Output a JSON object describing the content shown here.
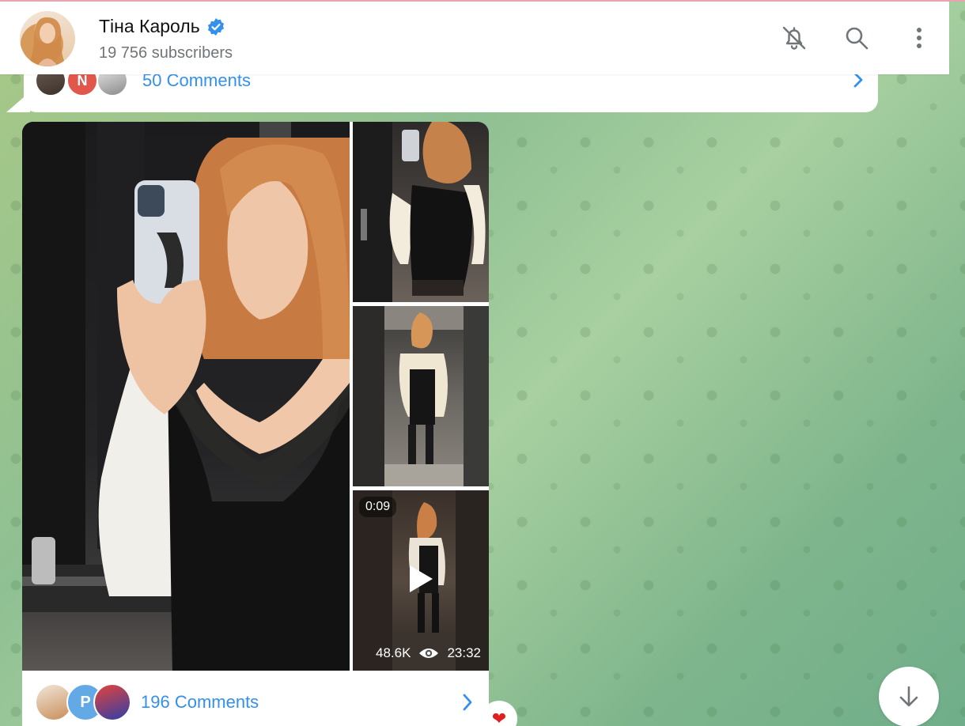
{
  "header": {
    "channel_name": "Тіна Кароль",
    "subscribers": "19 756 subscribers",
    "icons": [
      "mute-bell-icon",
      "search-icon",
      "more-vertical-icon"
    ]
  },
  "prev_message": {
    "comments_label": "50 Comments",
    "commenter_avatars": [
      "photo",
      "N",
      "photo"
    ]
  },
  "post": {
    "video": {
      "duration": "0:09",
      "views": "48.6K",
      "time": "23:32"
    },
    "comments_label": "196 Comments",
    "commenter_avatars": [
      "photo",
      "P",
      "photo"
    ]
  },
  "reaction": {
    "emoji": "❤"
  },
  "colors": {
    "accent": "#3390ec",
    "secondary_text": "#707579",
    "bubble": "#ffffff"
  }
}
